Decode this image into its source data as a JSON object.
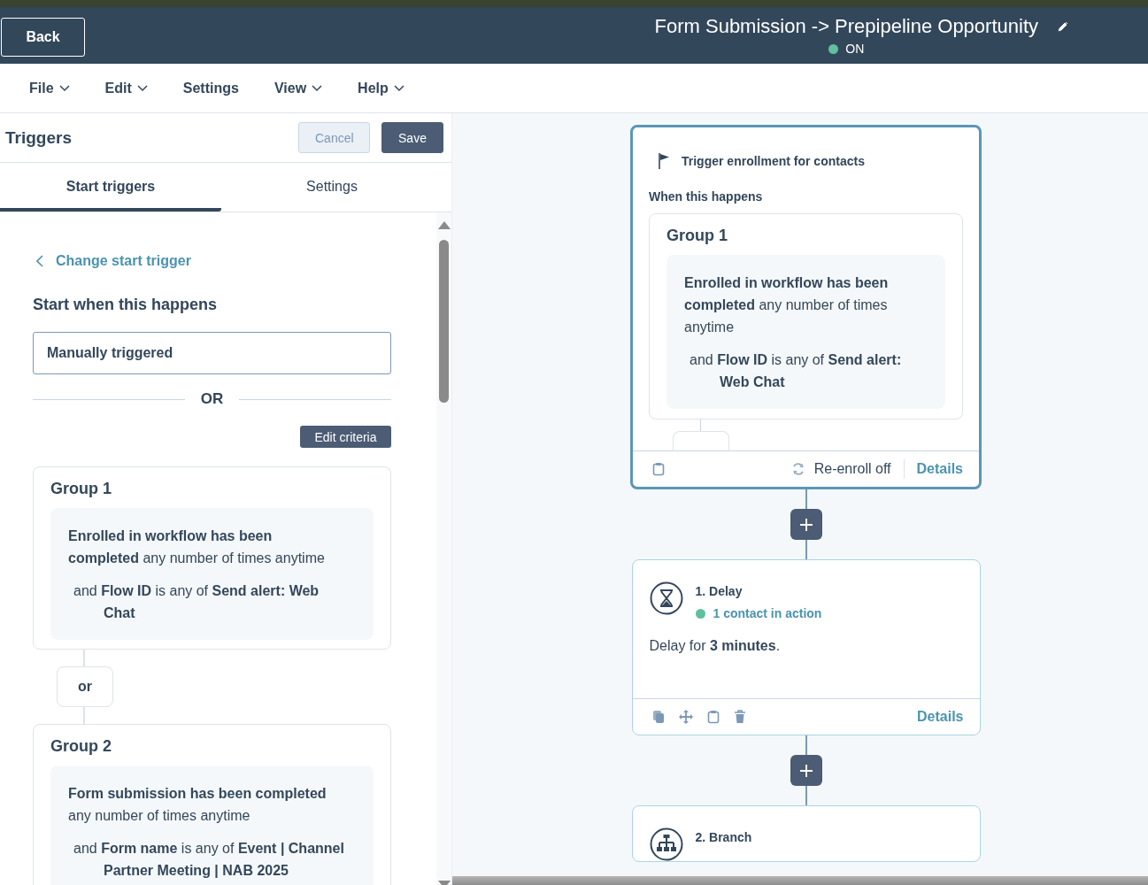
{
  "header": {
    "back_button": "Back",
    "title": "Form Submission -> Prepipeline Opportunity",
    "status": {
      "label": "ON",
      "on": true
    }
  },
  "menu": [
    {
      "label": "File",
      "dropdown": true
    },
    {
      "label": "Edit",
      "dropdown": true
    },
    {
      "label": "Settings",
      "dropdown": false
    },
    {
      "label": "View",
      "dropdown": true
    },
    {
      "label": "Help",
      "dropdown": true
    }
  ],
  "panel": {
    "title": "Triggers",
    "buttons": [
      {
        "label": "Cancel",
        "kind": "secondary"
      },
      {
        "label": "Save",
        "kind": "primary"
      }
    ],
    "tabs": [
      {
        "label": "Start triggers",
        "selected": true
      },
      {
        "label": "Settings",
        "selected": false
      }
    ],
    "back_link": "Change start trigger",
    "heading": "Start when this happens",
    "trigger_value": "Manually triggered",
    "separator": "OR",
    "edit_button": "Edit criteria",
    "groups": [
      {
        "title": "Group 1",
        "criteria": "**Enrolled in workflow has been completed** any number of times anytime",
        "filter": "and **Flow ID** is any of **Send alert: Web Chat**"
      },
      {
        "title": "Group 2",
        "criteria": "**Form submission has been completed** any number of times anytime",
        "filter": "and **Form name** is any of **Event | Channel Partner Meeting | NAB 2025**"
      }
    ],
    "joiner": "or"
  },
  "canvas": {
    "trigger_card": {
      "title": "Trigger enrollment for contacts",
      "subtitle": "When this happens",
      "group": {
        "title": "Group 1",
        "criteria": "**Enrolled in workflow has been completed** any number of times anytime",
        "filter": "and **Flow ID** is any of **Send alert: Web Chat**"
      },
      "reenroll": "Re-enroll off",
      "details": "Details"
    },
    "actions": [
      {
        "kind": "delay",
        "title": "1. Delay",
        "status": "1 contact in action",
        "body": "Delay for **3 minutes**.",
        "details": "Details"
      },
      {
        "kind": "branch",
        "title": "2. Branch"
      }
    ]
  }
}
